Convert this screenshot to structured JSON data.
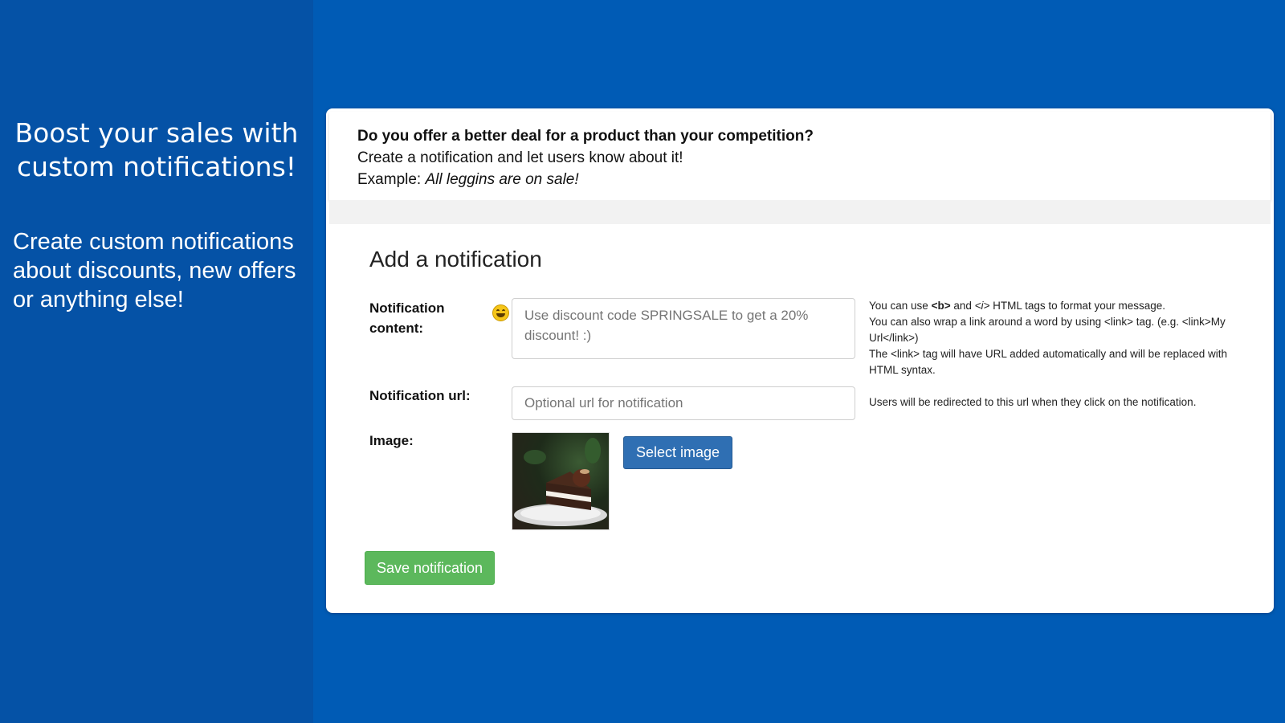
{
  "promo": {
    "headline": "Boost your sales with custom notifications!",
    "subtext": "Create custom notifications about discounts, new offers or anything else!"
  },
  "intro": {
    "question": "Do you offer a better deal for a product than your competition?",
    "line1": "Create a notification and let users know about it!",
    "example_prefix": "Example: ",
    "example_text": "All leggins are on sale!"
  },
  "form": {
    "title": "Add a notification",
    "content_label": "Notification content:",
    "content_placeholder": "Use discount code SPRINGSALE to get a 20% discount! :)",
    "content_help": [
      "You can also wrap a link around a word by using <link> tag. (e.g. <link>My Url</link>)",
      "The <link> tag will have URL added automatically and will be replaced with HTML syntax."
    ],
    "content_help_first": {
      "pre": "You can use ",
      "b_tag": "<b>",
      "mid": " and ",
      "i_tag": "<i>",
      "post": " HTML tags to format your message."
    },
    "url_label": "Notification url:",
    "url_placeholder": "Optional url for notification",
    "url_help": "Users will be redirected to this url when they click on the notification.",
    "image_label": "Image:",
    "select_image_label": "Select image",
    "save_label": "Save notification"
  },
  "icons": {
    "emoji": "smiley-emoji-icon"
  },
  "colors": {
    "background": "#005bb5",
    "left_panel": "#0552a6",
    "select_button": "#2f6fb3",
    "save_button": "#5cb85c"
  }
}
